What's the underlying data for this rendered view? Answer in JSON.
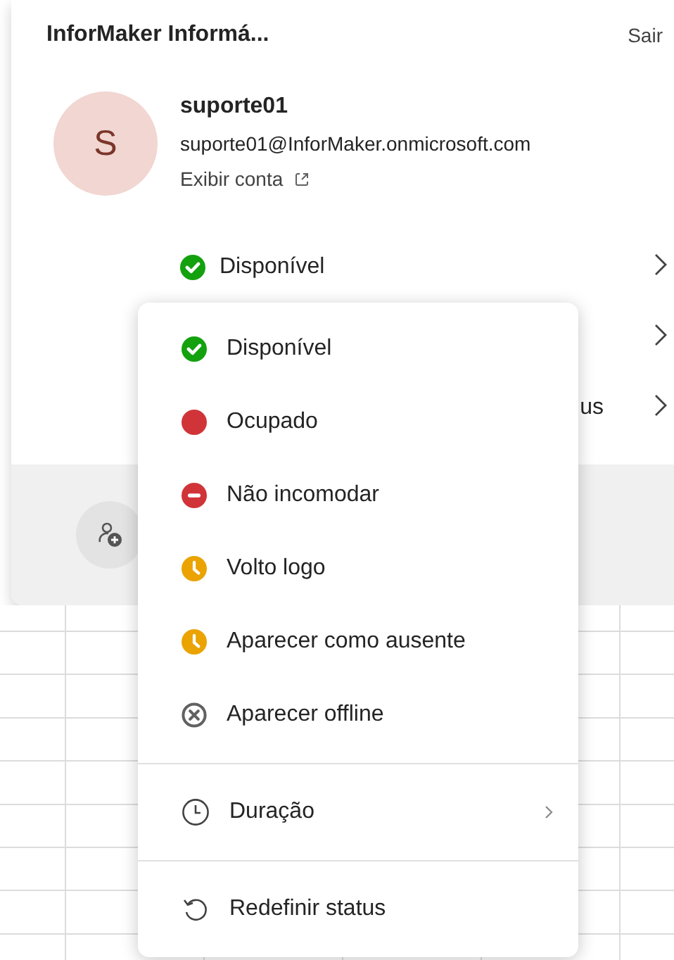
{
  "header": {
    "title": "InforMaker Informá...",
    "sign_out": "Sair"
  },
  "account": {
    "avatar_initial": "S",
    "name": "suporte01",
    "email": "suporte01@InforMaker.onmicrosoft.com",
    "view_account": "Exibir conta"
  },
  "rows": [
    {
      "kind": "available",
      "label": "Disponível"
    },
    {
      "kind": "covered"
    },
    {
      "kind": "covered",
      "label": "us"
    }
  ],
  "status_menu": {
    "statuses": [
      {
        "label": "Disponível",
        "kind": "available"
      },
      {
        "label": "Ocupado",
        "kind": "busy"
      },
      {
        "label": "Não incomodar",
        "kind": "dnd"
      },
      {
        "label": "Volto logo",
        "kind": "away"
      },
      {
        "label": "Aparecer como ausente",
        "kind": "away"
      },
      {
        "label": "Aparecer offline",
        "kind": "offline"
      }
    ],
    "duration": "Duração",
    "reset": "Redefinir status"
  }
}
